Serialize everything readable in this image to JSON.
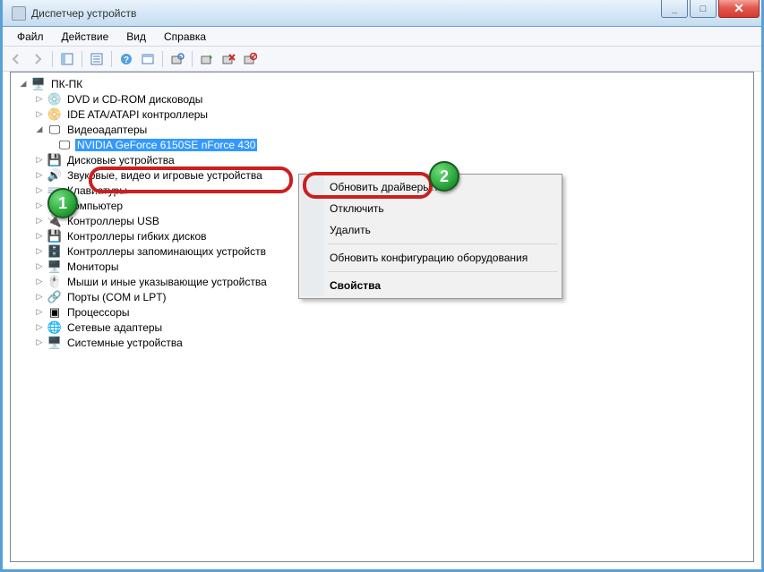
{
  "window": {
    "title": "Диспетчер устройств"
  },
  "menu": {
    "file": "Файл",
    "action": "Действие",
    "view": "Вид",
    "help": "Справка"
  },
  "tree": {
    "root": "ПК-ПК",
    "dvd": "DVD и CD-ROM дисководы",
    "ide": "IDE ATA/ATAPI контроллеры",
    "video": "Видеоадаптеры",
    "gpu": "NVIDIA GeForce 6150SE nForce 430",
    "floppy": "Дисковые устройства",
    "sound": "Звуковые, видео и игровые устройства",
    "keyboards": "Клавиатуры",
    "computer": "Компьютер",
    "usb": "Контроллеры USB",
    "fdc": "Контроллеры гибких дисков",
    "storage": "Контроллеры запоминающих устройств",
    "monitors": "Мониторы",
    "mice": "Мыши и иные указывающие устройства",
    "ports": "Порты (COM и LPT)",
    "cpu": "Процессоры",
    "nic": "Сетевые адаптеры",
    "system": "Системные устройства"
  },
  "context": {
    "update": "Обновить драйверы…",
    "disable": "Отключить",
    "delete": "Удалить",
    "scan": "Обновить конфигурацию оборудования",
    "properties": "Свойства"
  },
  "callouts": {
    "one": "1",
    "two": "2"
  }
}
